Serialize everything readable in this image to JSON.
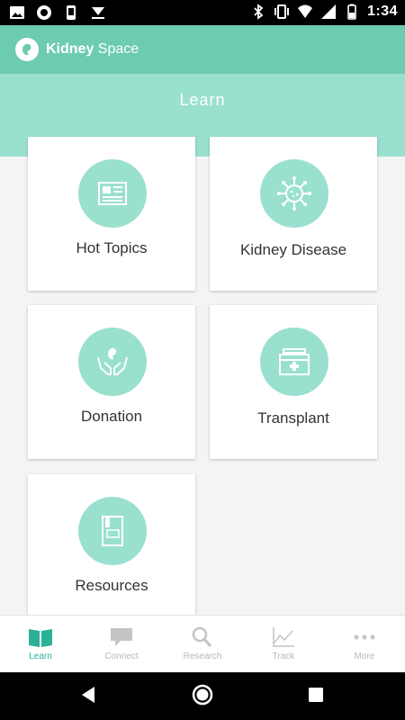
{
  "status_bar": {
    "time": "1:34",
    "left_icons": [
      "image-icon",
      "circle-icon",
      "phone-icon",
      "download-icon"
    ],
    "right_icons": [
      "bluetooth-icon",
      "vibrate-icon",
      "wifi-icon",
      "signal-icon",
      "battery-icon"
    ]
  },
  "app": {
    "brand_bold": "Kidney",
    "brand_rest": " Space",
    "accent": "#6ccbb0",
    "light_accent": "#9ae0cf"
  },
  "header": {
    "title": "Learn"
  },
  "cards": [
    {
      "label": "Hot Topics",
      "icon": "newspaper-icon"
    },
    {
      "label": "Kidney Disease",
      "icon": "virus-icon"
    },
    {
      "label": "Donation",
      "icon": "donation-hands-icon"
    },
    {
      "label": "Transplant",
      "icon": "medical-kit-icon"
    },
    {
      "label": "Resources",
      "icon": "book-icon"
    }
  ],
  "bottom_nav": [
    {
      "label": "Learn",
      "icon": "book-open-icon",
      "active": true
    },
    {
      "label": "Connect",
      "icon": "chat-bubble-icon",
      "active": false
    },
    {
      "label": "Research",
      "icon": "search-icon",
      "active": false
    },
    {
      "label": "Track",
      "icon": "chart-line-icon",
      "active": false
    },
    {
      "label": "More",
      "icon": "more-dots-icon",
      "active": false
    }
  ]
}
